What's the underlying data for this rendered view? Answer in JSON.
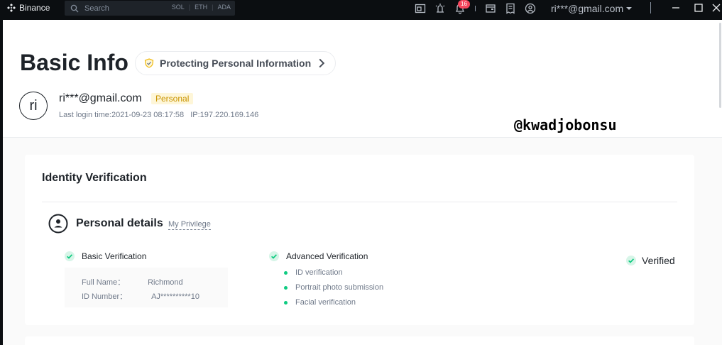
{
  "titlebar": {
    "app_name": "Binance",
    "search_placeholder": "Search",
    "tickers": [
      "SOL",
      "ETH",
      "ADA"
    ],
    "notification_count": "16",
    "account": "ri***@gmail.com"
  },
  "header": {
    "title": "Basic Info",
    "protect_link": "Protecting Personal Information",
    "avatar_initials": "ri",
    "email": "ri***@gmail.com",
    "account_type": "Personal",
    "last_login": "Last login time:2021-09-23 08:17:58",
    "ip": "IP:197.220.169.146"
  },
  "watermark": "@kwadjobonsu",
  "identity": {
    "title": "Identity Verification",
    "section_title": "Personal details",
    "privilege_link": "My Privilege",
    "basic": {
      "label": "Basic Verification",
      "full_name_label": "Full Name：",
      "full_name_value": "Richmond",
      "id_label": "ID Number：",
      "id_value": "AJ**********10"
    },
    "advanced": {
      "label": "Advanced Verification",
      "items": [
        "ID verification",
        "Portrait photo submission",
        "Facial verification"
      ]
    },
    "status": "Verified"
  },
  "colors": {
    "accent": "#f0b90b",
    "success": "#0ecb81",
    "text_primary": "#1e2329",
    "text_secondary": "#707a8a",
    "tag_bg": "#fef6d8",
    "tag_text": "#c99400"
  }
}
